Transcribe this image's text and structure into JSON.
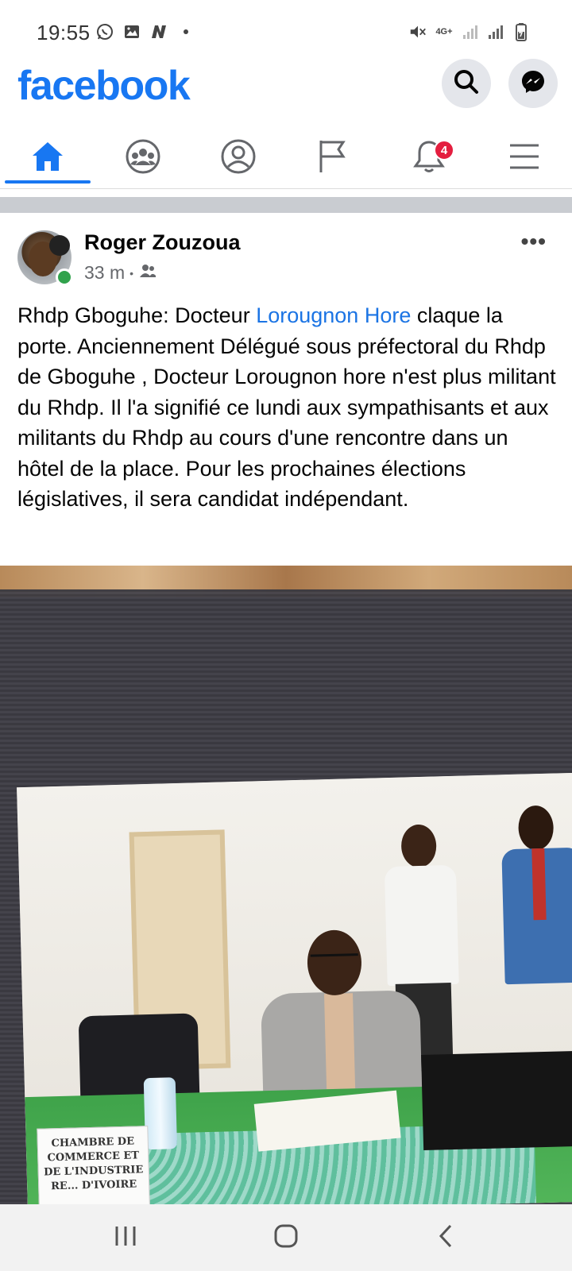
{
  "status_bar": {
    "time": "19:55",
    "left_icons": [
      "whatsapp-icon",
      "gallery-icon",
      "n-app-icon",
      "dot-icon"
    ],
    "right_icons": [
      "mute-icon",
      "4g-icon",
      "signal-icon",
      "signal-icon",
      "battery-icon"
    ],
    "network_label": "4G+"
  },
  "header": {
    "logo": "facebook",
    "brand_color": "#1877f2"
  },
  "tabs": [
    {
      "name": "home",
      "active": true
    },
    {
      "name": "groups",
      "active": false
    },
    {
      "name": "profile",
      "active": false
    },
    {
      "name": "pages",
      "active": false
    },
    {
      "name": "notifications",
      "active": false,
      "badge": "4"
    },
    {
      "name": "menu",
      "active": false
    }
  ],
  "notification_badge": "4",
  "post": {
    "author": "Roger Zouzoua",
    "time": "33 m",
    "separator": "•",
    "audience_icon": "friends-icon",
    "more_label": "•••",
    "text_before_link": "Rhdp Gboguhe: Docteur  ",
    "link_text": "Lorougnon Hore",
    "text_after_link": " claque la porte. Anciennement Délégué sous préfectoral du Rhdp de Gboguhe , Docteur Lorougnon hore n'est plus militant du Rhdp. Il l'a signifié ce lundi aux sympathisants et aux militants du Rhdp au cours d'une rencontre dans un hôtel de la place. Pour les prochaines élections législatives, il sera candidat indépendant.",
    "photo_card_lines": [
      "CHAMBRE DE",
      "COMMERCE ET",
      "DE L'INDUSTRIE",
      "RE... D'IVOIRE"
    ]
  },
  "nav": {
    "buttons": [
      "recents-icon",
      "home-icon",
      "back-icon"
    ]
  }
}
